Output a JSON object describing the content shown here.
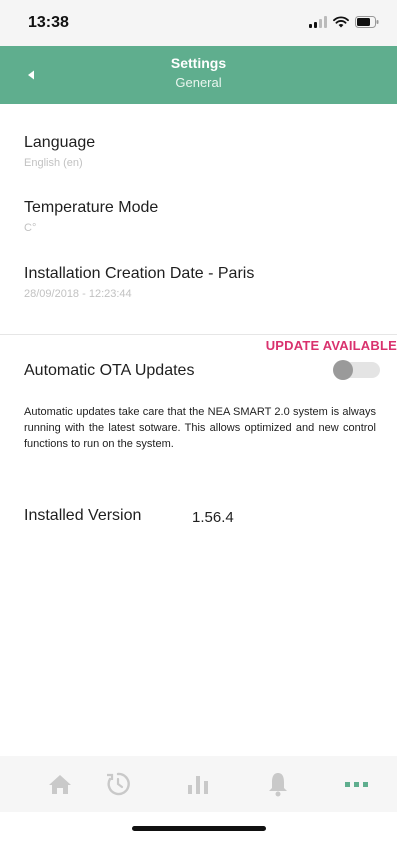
{
  "status_bar": {
    "time": "13:38"
  },
  "header": {
    "title": "Settings",
    "subtitle": "General",
    "back_icon": "back-arrow-icon"
  },
  "settings": {
    "language": {
      "label": "Language",
      "value": "English (en)"
    },
    "temperature_mode": {
      "label": "Temperature Mode",
      "value": "C°"
    },
    "installation_date": {
      "label": "Installation Creation Date - Paris",
      "value": "28/09/2018 - 12:23:44"
    }
  },
  "ota": {
    "badge": "UPDATE AVAILABLE",
    "label": "Automatic OTA Updates",
    "enabled": false,
    "description": "Automatic updates take care that the NEA SMART 2.0 system is always running with the latest sotware. This allows optimized and new control functions to run on the system."
  },
  "installed_version": {
    "label": "Installed Version",
    "value": "1.56.4"
  },
  "tab_bar": {
    "items": [
      "home-icon",
      "schedule-icon",
      "statistics-icon",
      "notifications-icon",
      "more-icon"
    ],
    "active": "more-icon"
  },
  "colors": {
    "header": "#5fae8e",
    "badge": "#d9326e",
    "tab_active": "#5fae8e",
    "tab_inactive": "#c9c9c9"
  }
}
